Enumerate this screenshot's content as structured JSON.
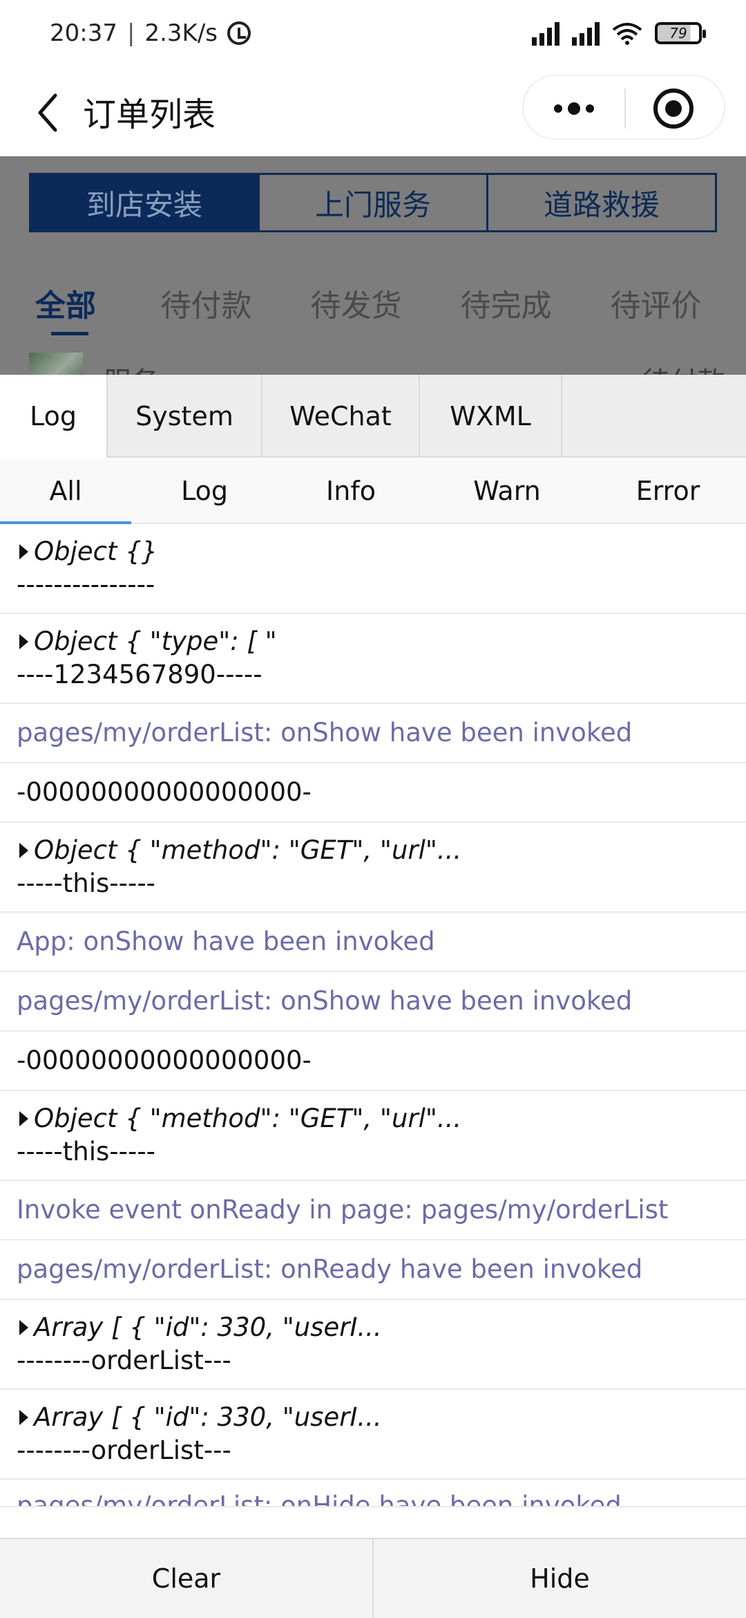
{
  "status_bar": {
    "time": "20:37",
    "net_speed": "2.3K/s",
    "battery": "79"
  },
  "nav": {
    "title": "订单列表"
  },
  "page_behind": {
    "segments": [
      "到店安装",
      "上门服务",
      "道路救援"
    ],
    "order_tabs": [
      "全部",
      "待付款",
      "待发货",
      "待完成",
      "待评价"
    ],
    "row_name": "服务",
    "row_status": "待付款"
  },
  "console": {
    "tabs": [
      "Log",
      "System",
      "WeChat",
      "WXML"
    ],
    "filters": [
      "All",
      "Log",
      "Info",
      "Warn",
      "Error"
    ],
    "entries": [
      {
        "kind": "obj",
        "line1": "Object {}",
        "line2": "---------------"
      },
      {
        "kind": "obj",
        "line1": "Object { \"type\": [ \"",
        "line2": "----1234567890-----"
      },
      {
        "kind": "info",
        "text": "pages/my/orderList: onShow have been invoked"
      },
      {
        "kind": "plain",
        "text": "-00000000000000000-"
      },
      {
        "kind": "obj",
        "line1": "Object { \"method\": \"GET\", \"url\"...",
        "line2": "-----this-----"
      },
      {
        "kind": "info",
        "text": "App: onShow have been invoked"
      },
      {
        "kind": "info",
        "text": "pages/my/orderList: onShow have been invoked"
      },
      {
        "kind": "plain",
        "text": "-00000000000000000-"
      },
      {
        "kind": "obj",
        "line1": "Object { \"method\": \"GET\", \"url\"...",
        "line2": "-----this-----"
      },
      {
        "kind": "info",
        "text": "Invoke event onReady in page: pages/my/orderList"
      },
      {
        "kind": "info",
        "text": "pages/my/orderList: onReady have been invoked"
      },
      {
        "kind": "obj",
        "line1": "Array [ { \"id\": 330, \"userI...",
        "line2": "--------orderList---"
      },
      {
        "kind": "obj",
        "line1": "Array [ { \"id\": 330, \"userI...",
        "line2": "--------orderList---"
      },
      {
        "kind": "clipped",
        "text": "pages/my/orderList: onHide have been invoked"
      }
    ],
    "clear_label": "Clear",
    "hide_label": "Hide"
  }
}
